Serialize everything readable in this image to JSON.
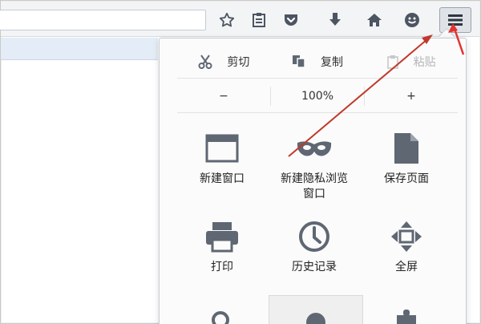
{
  "edit": {
    "cut_label": "剪切",
    "copy_label": "复制",
    "paste_label": "粘贴"
  },
  "zoom": {
    "minus_label": "−",
    "level": "100%",
    "plus_label": "+"
  },
  "menu_items": [
    {
      "label": "新建窗口",
      "icon": "new-window-icon"
    },
    {
      "label": "新建隐私浏览\n窗口",
      "icon": "private-mask-icon"
    },
    {
      "label": "保存页面",
      "icon": "save-page-icon"
    },
    {
      "label": "打印",
      "icon": "print-icon"
    },
    {
      "label": "历史记录",
      "icon": "history-clock-icon"
    },
    {
      "label": "全屏",
      "icon": "fullscreen-icon"
    }
  ],
  "toolbar_icons": [
    "bookmark-star-icon",
    "reading-list-icon",
    "pocket-icon",
    "download-icon",
    "home-icon",
    "smiley-icon",
    "hamburger-menu-icon"
  ],
  "colors": {
    "icon": "#5f6773",
    "annotation_arrow": "#c0392b",
    "menu_button_bg": "#dfe3e8"
  }
}
